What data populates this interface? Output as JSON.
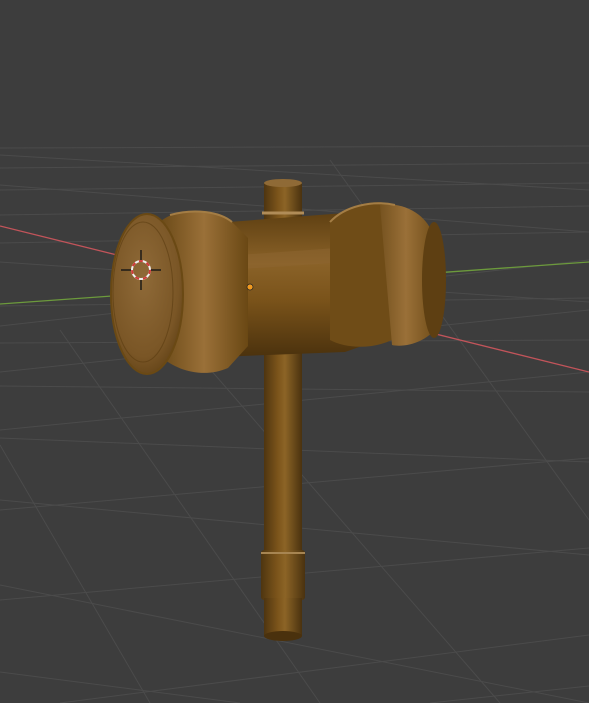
{
  "viewport": {
    "background": "#3d3d3d",
    "grid_color": "#4b4b4b",
    "x_axis_color": "#c2545a",
    "y_axis_color": "#6c9a3c",
    "origin_color": "#f29a1f"
  },
  "object": {
    "material_color": "#7a531a",
    "highlight_color": "#9a7038",
    "shadow_color": "#4d340f"
  },
  "cursor": {
    "icon": "3d-cursor-icon",
    "ring_color_a": "#d13a3a",
    "ring_color_b": "#f0f0f0"
  }
}
